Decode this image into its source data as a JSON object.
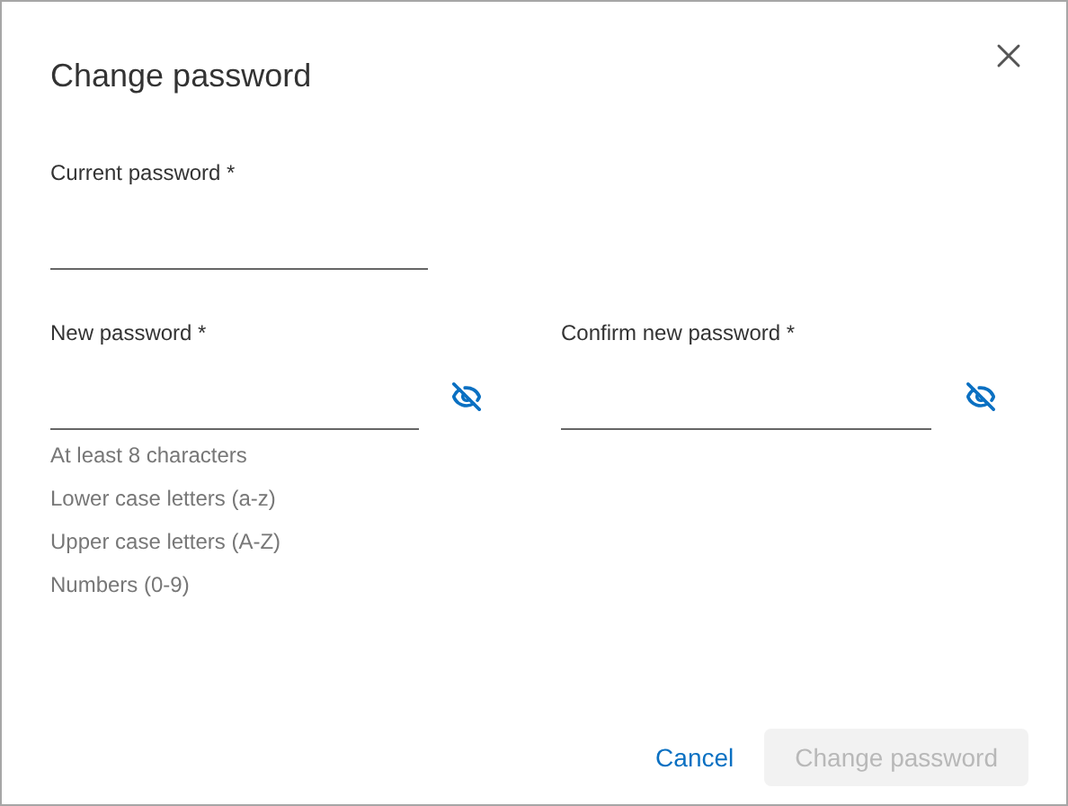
{
  "dialog": {
    "title": "Change password"
  },
  "current_password": {
    "label": "Current password *"
  },
  "new_password": {
    "label": "New password *",
    "password_visible": false
  },
  "confirm_password": {
    "label": "Confirm new password *",
    "password_visible": false
  },
  "requirements": [
    {
      "text": "At least 8 characters"
    },
    {
      "text": "Lower case letters (a-z)"
    },
    {
      "text": "Upper case letters (A-Z)"
    },
    {
      "text": "Numbers (0-9)"
    }
  ],
  "buttons": {
    "cancel": {
      "label": "Cancel"
    },
    "submit": {
      "label": "Change password",
      "disabled": true
    }
  }
}
